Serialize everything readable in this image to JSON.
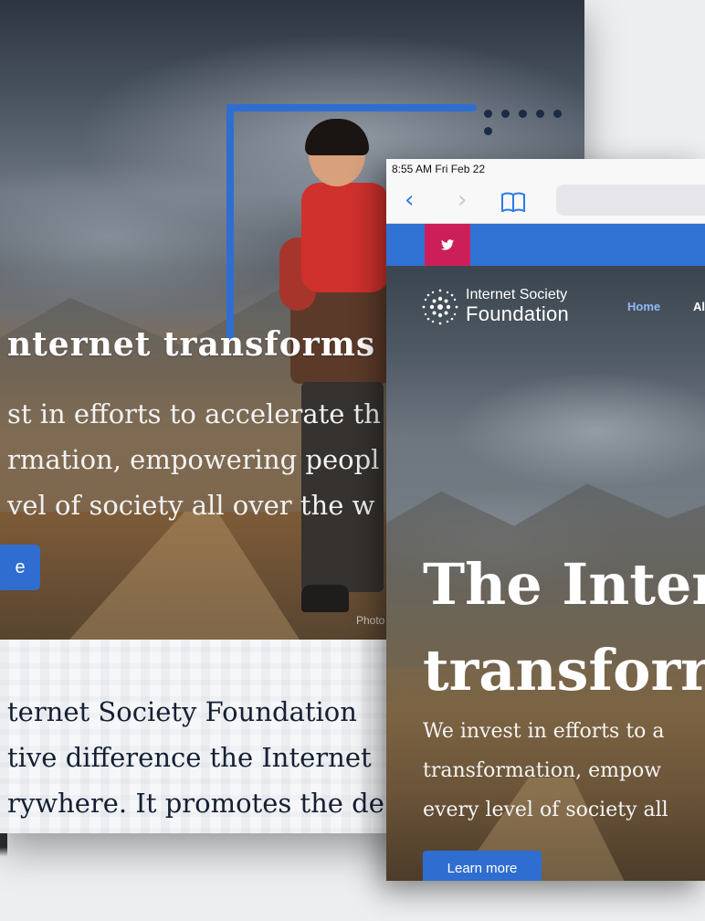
{
  "back_device": {
    "hero_title": "nternet transforms l",
    "hero_description": "st in efforts to accelerate th\nrmation, empowering peopl\nvel of society all over the w",
    "cta_partial": "e",
    "photo_credit": "Photo",
    "about_text": "ternet Society Foundation\ntive difference the Internet\nrywhere. It promotes the de"
  },
  "tablet": {
    "status_time": "8:55 AM  Fri Feb 22",
    "site": {
      "logo_line1": "Internet Society",
      "logo_line2": "Foundation",
      "nav": {
        "home": "Home",
        "about_partial": "Al"
      },
      "hero_title": "The Inter\ntransforr",
      "hero_description": "We invest in efforts to a\ntransformation, empow\nevery level of society all",
      "learn_more": "Learn more"
    }
  },
  "colors": {
    "brand_blue": "#2f72d4",
    "twitter_accent": "#cc1f5a",
    "nav_active": "#8fb9f5"
  },
  "icons": [
    "back-chevron-icon",
    "forward-chevron-icon",
    "bookmarks-icon",
    "twitter-icon",
    "foundation-logo-icon"
  ]
}
